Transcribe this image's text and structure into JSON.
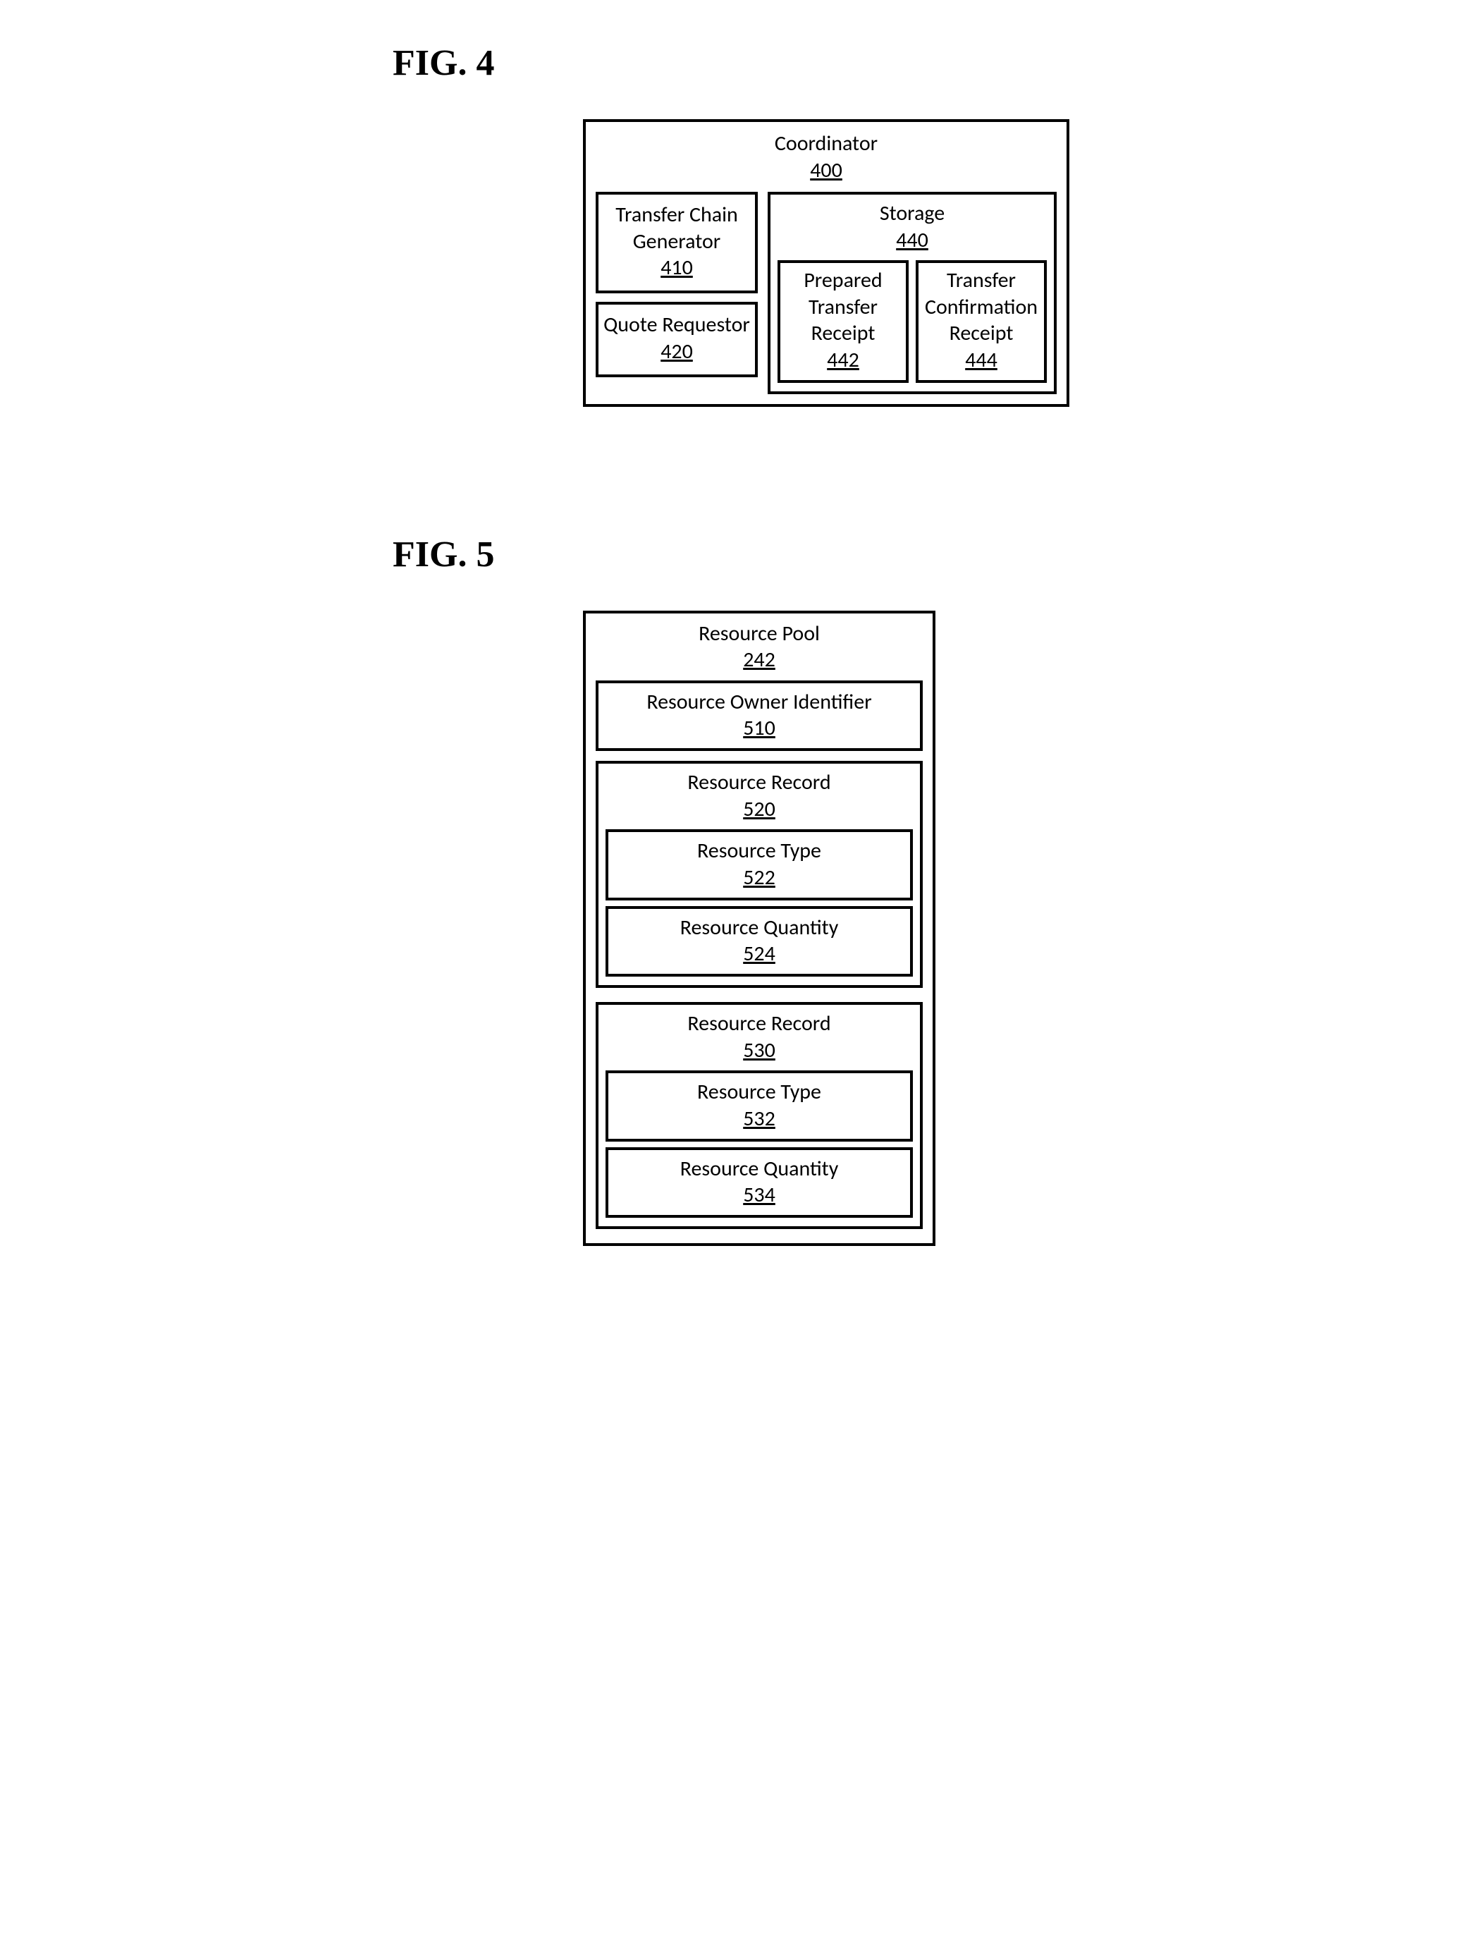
{
  "fig4": {
    "label": "FIG. 4",
    "coordinator": {
      "title": "Coordinator",
      "ref": "400"
    },
    "transferChainGenerator": {
      "title": "Transfer Chain Generator",
      "ref": "410"
    },
    "quoteRequestor": {
      "title": "Quote Requestor",
      "ref": "420"
    },
    "storage": {
      "title": "Storage",
      "ref": "440"
    },
    "preparedTransferReceipt": {
      "title": "Prepared Transfer Receipt",
      "ref": "442"
    },
    "transferConfirmationReceipt": {
      "title": "Transfer Confirmation Receipt",
      "ref": "444"
    }
  },
  "fig5": {
    "label": "FIG. 5",
    "resourcePool": {
      "title": "Resource Pool",
      "ref": "242"
    },
    "resourceOwnerIdentifier": {
      "title": "Resource Owner Identifier",
      "ref": "510"
    },
    "record1": {
      "title": "Resource Record",
      "ref": "520",
      "type": {
        "title": "Resource Type",
        "ref": "522"
      },
      "qty": {
        "title": "Resource Quantity",
        "ref": "524"
      }
    },
    "record2": {
      "title": "Resource Record",
      "ref": "530",
      "type": {
        "title": "Resource Type",
        "ref": "532"
      },
      "qty": {
        "title": "Resource Quantity",
        "ref": "534"
      }
    }
  }
}
